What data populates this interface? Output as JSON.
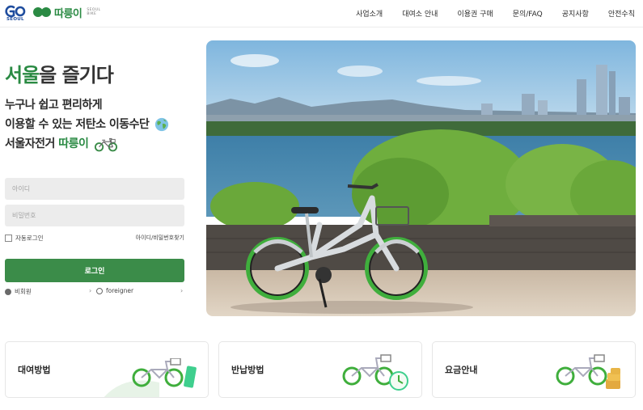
{
  "header": {
    "logo_seoul": "SEOUL",
    "logo_name": "따릉이",
    "logo_sub_1": "SEOUL",
    "logo_sub_2": "BIKE",
    "nav": [
      "사업소개",
      "대여소 안내",
      "이용권 구매",
      "문의/FAQ",
      "공지사항",
      "안전수칙"
    ]
  },
  "intro": {
    "headline_hl": "서울",
    "headline_rest": "을 즐기다",
    "line1": "누구나 쉽고 편리하게",
    "line2": "이용할 수 있는 저탄소 이동수단",
    "line3_a": "서울자전거 ",
    "line3_b": "따릉이"
  },
  "login": {
    "id_placeholder": "아이디",
    "pw_placeholder": "비밀번호",
    "auto_login": "자동로그인",
    "find_link": "아이디/비밀번호찾기",
    "button": "로그인",
    "guest": "비회원",
    "foreigner": "foreigner"
  },
  "cards": [
    {
      "label": "대여방법",
      "icon": "bike-rent-icon"
    },
    {
      "label": "반납방법",
      "icon": "bike-return-clock-icon"
    },
    {
      "label": "요금안내",
      "icon": "bike-coins-icon"
    }
  ],
  "colors": {
    "brand_green": "#3b8c49",
    "logo_blue": "#1f4d9e"
  }
}
